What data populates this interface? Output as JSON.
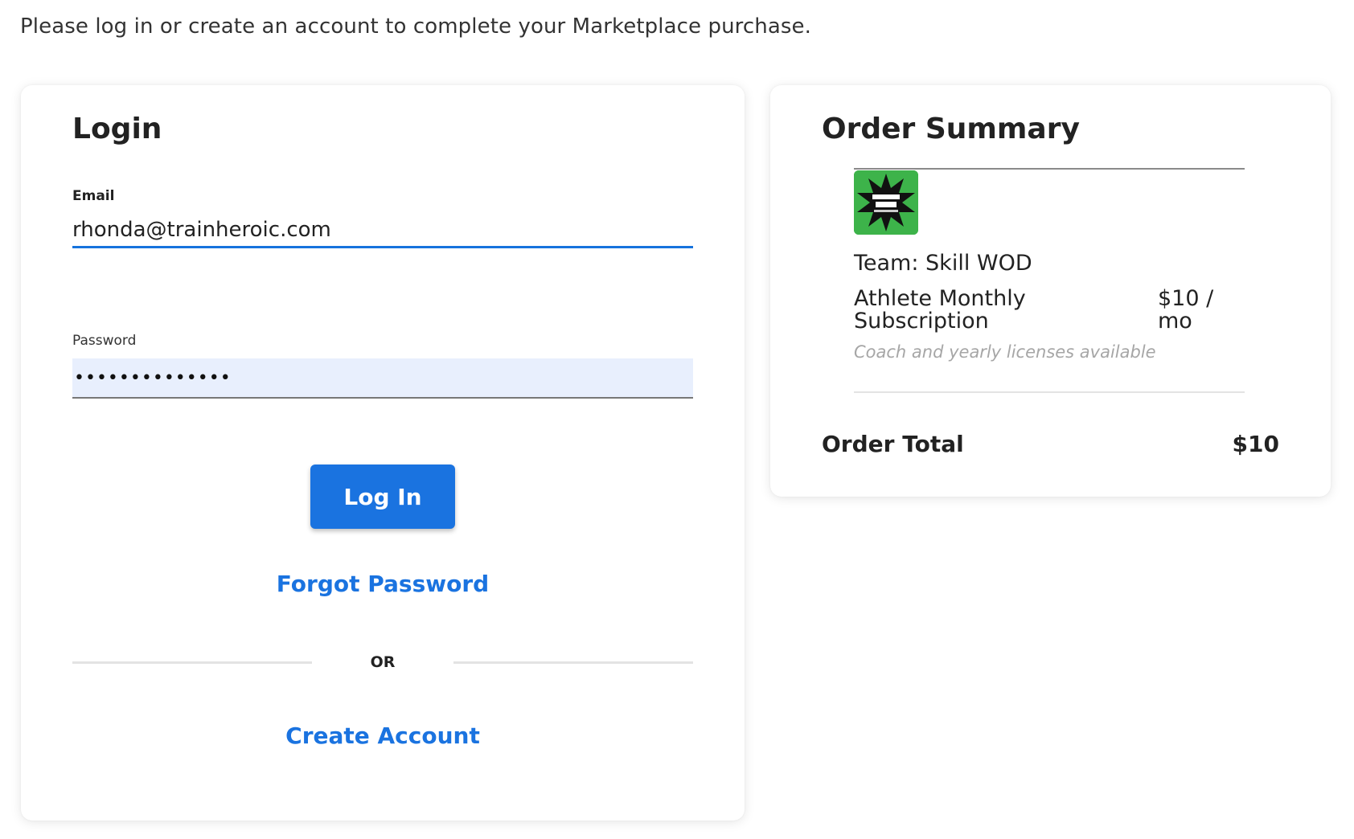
{
  "intro_text": "Please log in or create an account to complete your Marketplace purchase.",
  "login": {
    "title": "Login",
    "email_label": "Email",
    "email_value": "rhonda@trainheroic.com",
    "password_label": "Password",
    "password_value": "••••••••••••••",
    "login_button": "Log In",
    "forgot_password": "Forgot Password",
    "or_text": "OR",
    "create_account": "Create Account"
  },
  "order": {
    "title": "Order Summary",
    "team_logo_icon": "skill-wod-logo-icon",
    "team_name": "Team: Skill WOD",
    "plan_name": "Athlete Monthly Subscription",
    "plan_price": "$10 / mo",
    "licenses_note": "Coach and yearly licenses available",
    "total_label": "Order Total",
    "total_value": "$10"
  },
  "colors": {
    "accent": "#1a73e0",
    "logo_bg": "#3db34a",
    "password_bg": "#e8effd",
    "muted_text": "#a6a6a6"
  }
}
